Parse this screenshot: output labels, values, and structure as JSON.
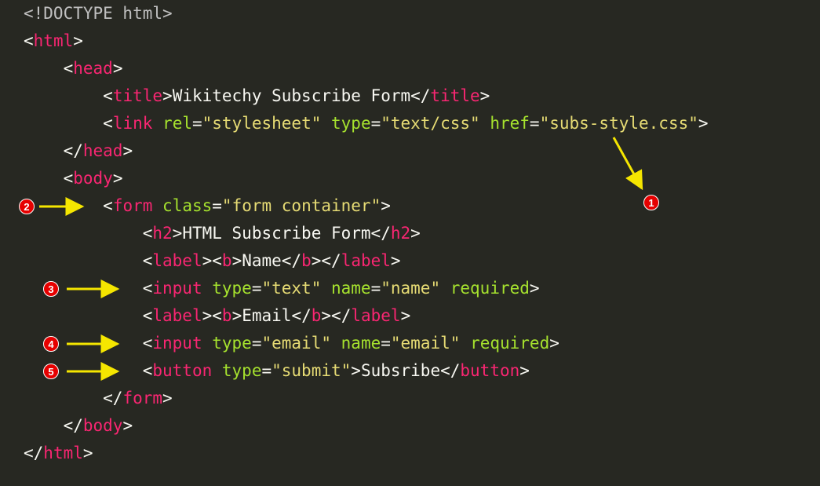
{
  "code": {
    "l1_doctype": "<!DOCTYPE html>",
    "l2": {
      "open": "<",
      "tag": "html",
      "close": ">"
    },
    "l3": {
      "open": "<",
      "tag": "head",
      "close": ">"
    },
    "l4": {
      "o1": "<",
      "t1": "title",
      "c1": ">",
      "txt": "Wikitechy Subscribe Form",
      "o2": "</",
      "t2": "title",
      "c2": ">"
    },
    "l5": {
      "open": "<",
      "tag": "link",
      "a1": "rel",
      "v1": "\"stylesheet\"",
      "a2": "type",
      "v2": "\"text/css\"",
      "a3": "href",
      "v3": "\"subs-style.css\"",
      "close": ">"
    },
    "l6": {
      "open": "</",
      "tag": "head",
      "close": ">"
    },
    "l7": {
      "open": "<",
      "tag": "body",
      "close": ">"
    },
    "l8": {
      "open": "<",
      "tag": "form",
      "attr": "class",
      "val": "\"form container\"",
      "close": ">"
    },
    "l9": {
      "o1": "<",
      "t1": "h2",
      "c1": ">",
      "txt": "HTML Subscribe Form",
      "o2": "</",
      "t2": "h2",
      "c2": ">"
    },
    "l10": {
      "o1": "<",
      "t1": "label",
      "c1": ">",
      "o2": "<",
      "t2": "b",
      "c2": ">",
      "txt": "Name",
      "o3": "</",
      "t3": "b",
      "c3": ">",
      "o4": "</",
      "t4": "label",
      "c4": ">"
    },
    "l11": {
      "open": "<",
      "tag": "input",
      "a1": "type",
      "v1": "\"text\"",
      "a2": "name",
      "v2": "\"name\"",
      "a3": "required",
      "close": ">"
    },
    "l12": {
      "o1": "<",
      "t1": "label",
      "c1": ">",
      "o2": "<",
      "t2": "b",
      "c2": ">",
      "txt": "Email",
      "o3": "</",
      "t3": "b",
      "c3": ">",
      "o4": "</",
      "t4": "label",
      "c4": ">"
    },
    "l13": {
      "open": "<",
      "tag": "input",
      "a1": "type",
      "v1": "\"email\"",
      "a2": "name",
      "v2": "\"email\"",
      "a3": "required",
      "close": ">"
    },
    "l14": {
      "open": "<",
      "tag": "button",
      "a1": "type",
      "v1": "\"submit\"",
      "c1": ">",
      "txt": "Subsribe",
      "o2": "</",
      "t2": "button",
      "c2": ">"
    },
    "l15": {
      "open": "</",
      "tag": "form",
      "close": ">"
    },
    "l16": {
      "open": "</",
      "tag": "body",
      "close": ">"
    },
    "l17": {
      "open": "</",
      "tag": "html",
      "close": ">"
    }
  },
  "annotations": {
    "b1": "1",
    "b2": "2",
    "b3": "3",
    "b4": "4",
    "b5": "5"
  }
}
